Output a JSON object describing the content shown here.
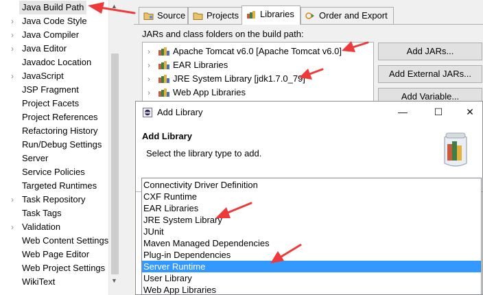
{
  "left_tree": {
    "items": [
      {
        "label": "Java Build Path",
        "expandable": false,
        "selected": true
      },
      {
        "label": "Java Code Style",
        "expandable": true
      },
      {
        "label": "Java Compiler",
        "expandable": true
      },
      {
        "label": "Java Editor",
        "expandable": true
      },
      {
        "label": "Javadoc Location",
        "expandable": false
      },
      {
        "label": "JavaScript",
        "expandable": true
      },
      {
        "label": "JSP Fragment",
        "expandable": false
      },
      {
        "label": "Project Facets",
        "expandable": false
      },
      {
        "label": "Project References",
        "expandable": false
      },
      {
        "label": "Refactoring History",
        "expandable": false
      },
      {
        "label": "Run/Debug Settings",
        "expandable": false
      },
      {
        "label": "Server",
        "expandable": false
      },
      {
        "label": "Service Policies",
        "expandable": false
      },
      {
        "label": "Targeted Runtimes",
        "expandable": false
      },
      {
        "label": "Task Repository",
        "expandable": true
      },
      {
        "label": "Task Tags",
        "expandable": false
      },
      {
        "label": "Validation",
        "expandable": true
      },
      {
        "label": "Web Content Settings",
        "expandable": false
      },
      {
        "label": "Web Page Editor",
        "expandable": false
      },
      {
        "label": "Web Project Settings",
        "expandable": false
      },
      {
        "label": "WikiText",
        "expandable": false
      }
    ]
  },
  "tabs": [
    {
      "label": "Source",
      "icon": "source-folder-icon"
    },
    {
      "label": "Projects",
      "icon": "projects-folder-icon"
    },
    {
      "label": "Libraries",
      "icon": "libraries-icon",
      "active": true
    },
    {
      "label": "Order and Export",
      "icon": "order-export-icon"
    }
  ],
  "build_path": {
    "label": "JARs and class folders on the build path:",
    "entries": [
      "Apache Tomcat v6.0 [Apache Tomcat v6.0]",
      "EAR Libraries",
      "JRE System Library [jdk1.7.0_79]",
      "Web App Libraries"
    ]
  },
  "buttons": {
    "add_jars": "Add JARs...",
    "add_external_jars": "Add External JARs...",
    "add_variable": "Add Variable..."
  },
  "dialog": {
    "title": "Add Library",
    "heading": "Add Library",
    "description": "Select the library type to add.",
    "library_types": [
      "Connectivity Driver Definition",
      "CXF Runtime",
      "EAR Libraries",
      "JRE System Library",
      "JUnit",
      "Maven Managed Dependencies",
      "Plug-in Dependencies",
      "Server Runtime",
      "User Library",
      "Web App Libraries"
    ],
    "selected_type": "Server Runtime"
  },
  "colors": {
    "selection": "#3399ff",
    "annotation_arrow": "#ee3a3a"
  }
}
